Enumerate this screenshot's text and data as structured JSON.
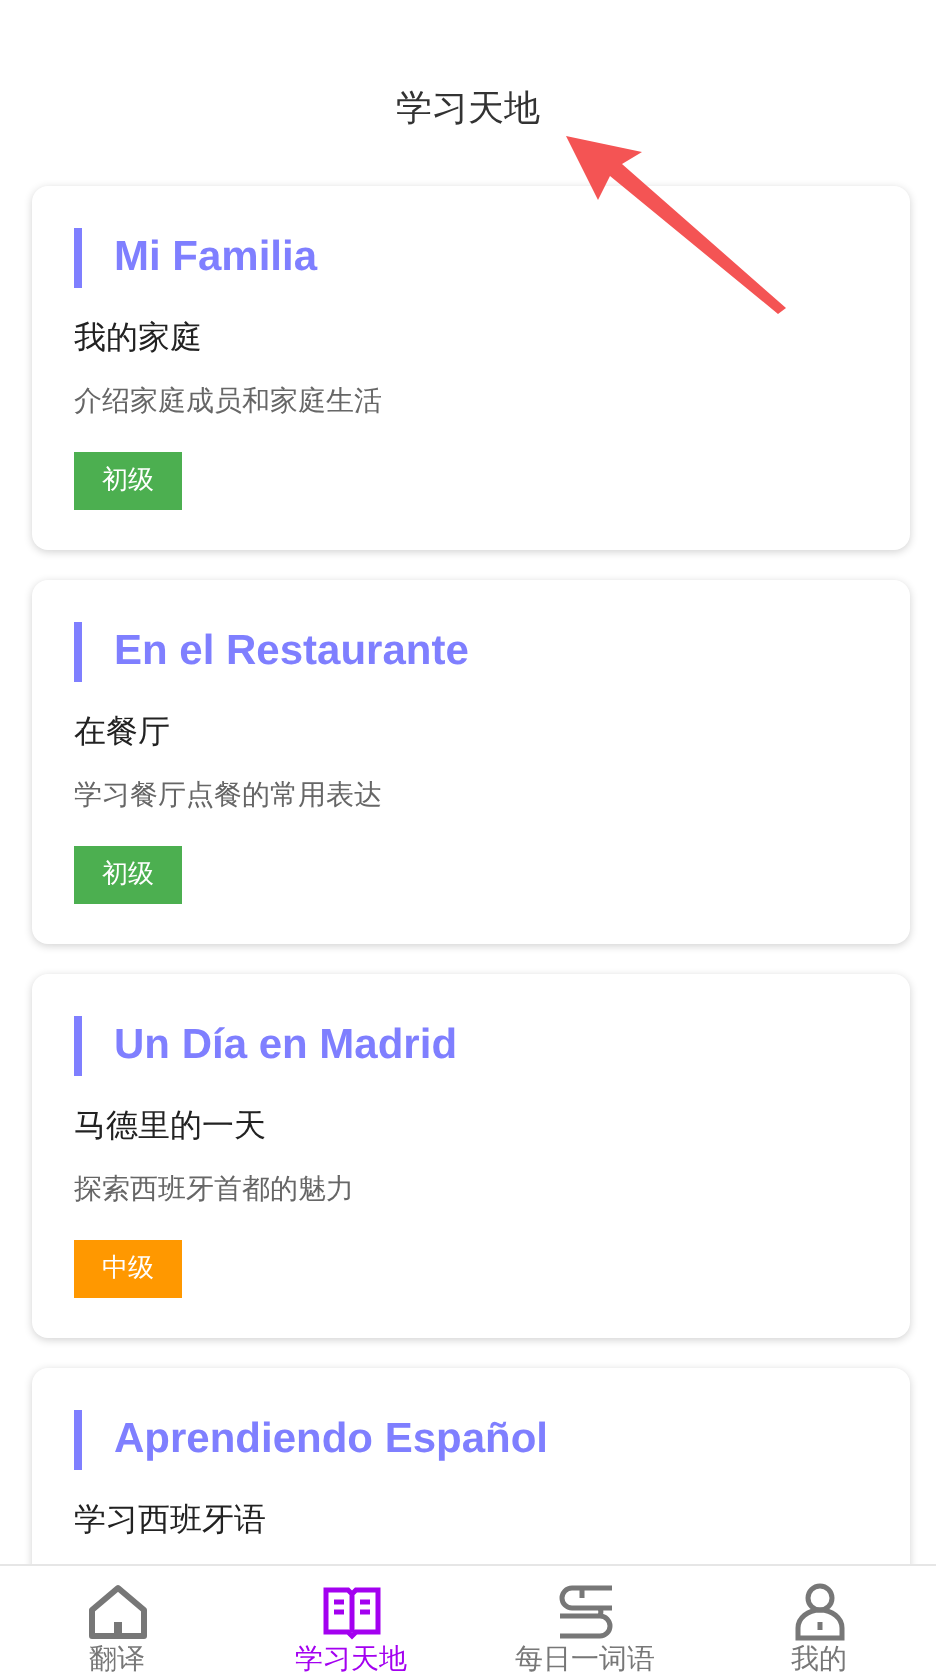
{
  "header": {
    "title": "学习天地"
  },
  "lessons": [
    {
      "title": "Mi Familia",
      "subtitle": "我的家庭",
      "description": "介绍家庭成员和家庭生活",
      "level_tag": {
        "label": "初级",
        "color": "#4caf50"
      }
    },
    {
      "title": "En el Restaurante",
      "subtitle": "在餐厅",
      "description": "学习餐厅点餐的常用表达",
      "level_tag": {
        "label": "初级",
        "color": "#4caf50"
      }
    },
    {
      "title": "Un Día en Madrid",
      "subtitle": "马德里的一天",
      "description": "探索西班牙首都的魅力",
      "level_tag": {
        "label": "中级",
        "color": "#ff9800"
      }
    },
    {
      "title": "Aprendiendo Español",
      "subtitle": "学习西班牙语"
    }
  ],
  "bottom_nav": [
    {
      "label": "翻译",
      "kind": "home",
      "selected": false
    },
    {
      "label": "学习天地",
      "kind": "book",
      "selected": true
    },
    {
      "label": "每日一词语",
      "kind": "books",
      "selected": false
    },
    {
      "label": "我的",
      "kind": "person",
      "selected": false
    }
  ]
}
